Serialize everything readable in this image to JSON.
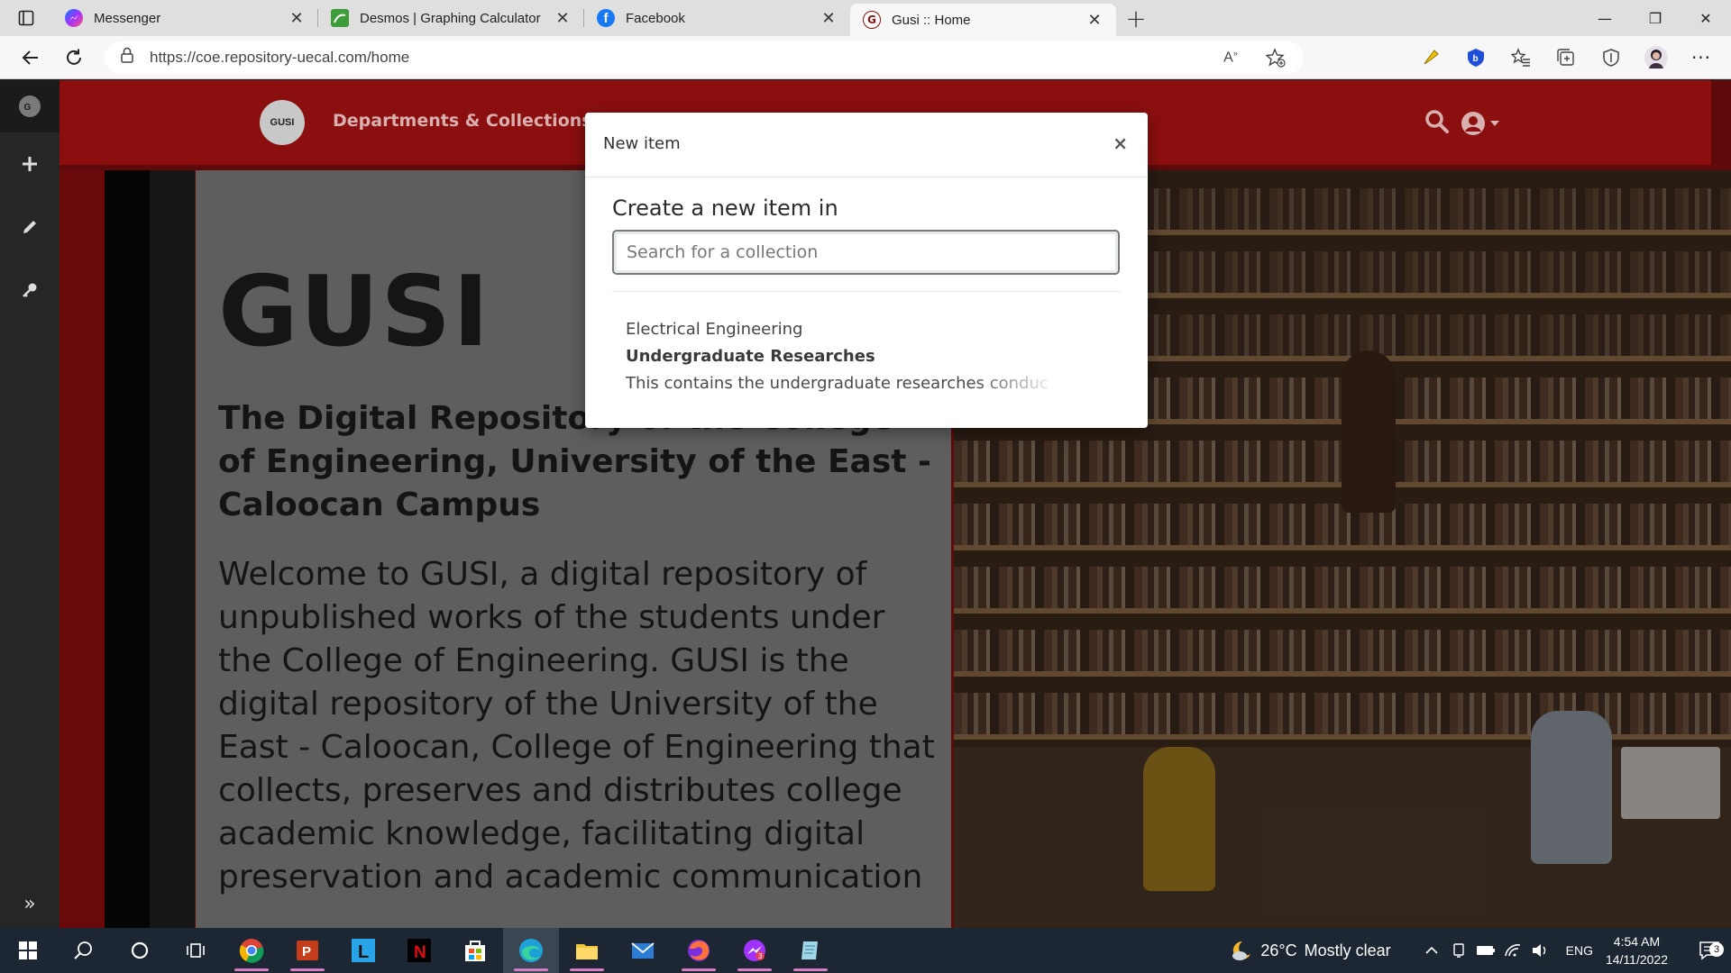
{
  "browser": {
    "tabs": [
      {
        "title": "Messenger",
        "icon": "messenger-icon",
        "active": false
      },
      {
        "title": "Desmos | Graphing Calculator",
        "icon": "desmos-icon",
        "active": false
      },
      {
        "title": "Facebook",
        "icon": "facebook-icon",
        "active": false
      },
      {
        "title": "Gusi :: Home",
        "icon": "gusi-icon",
        "active": true
      }
    ],
    "url": "https://coe.repository-uecal.com/home"
  },
  "site": {
    "logo_text": "GUSI",
    "nav_link": "Departments & Collections",
    "hero_title": "GUSI",
    "hero_subtitle": "The Digital Repository of the College of Engineering, University of the East - Caloocan Campus",
    "hero_body": "Welcome to GUSI, a digital repository of unpublished works of the students under the College of Engineering. GUSI is the digital repository of the University of the East - Caloocan, College of Engineering that collects, preserves and distributes college academic knowledge, facilitating digital preservation and academic communication",
    "colors": {
      "brand_red": "#8c0f0f",
      "dark": "#151515"
    }
  },
  "modal": {
    "title": "New item",
    "close_label": "×",
    "heading": "Create a new item in",
    "search_placeholder": "Search for a collection",
    "search_value": "",
    "results": [
      {
        "parent": "Electrical Engineering",
        "name": "Undergraduate Researches",
        "description": "This contains the undergraduate researches conduc"
      }
    ]
  },
  "taskbar": {
    "weather_temp": "26°C",
    "weather_text": "Mostly clear",
    "language": "ENG",
    "time": "4:54 AM",
    "date": "14/11/2022",
    "notification_count": "3"
  }
}
